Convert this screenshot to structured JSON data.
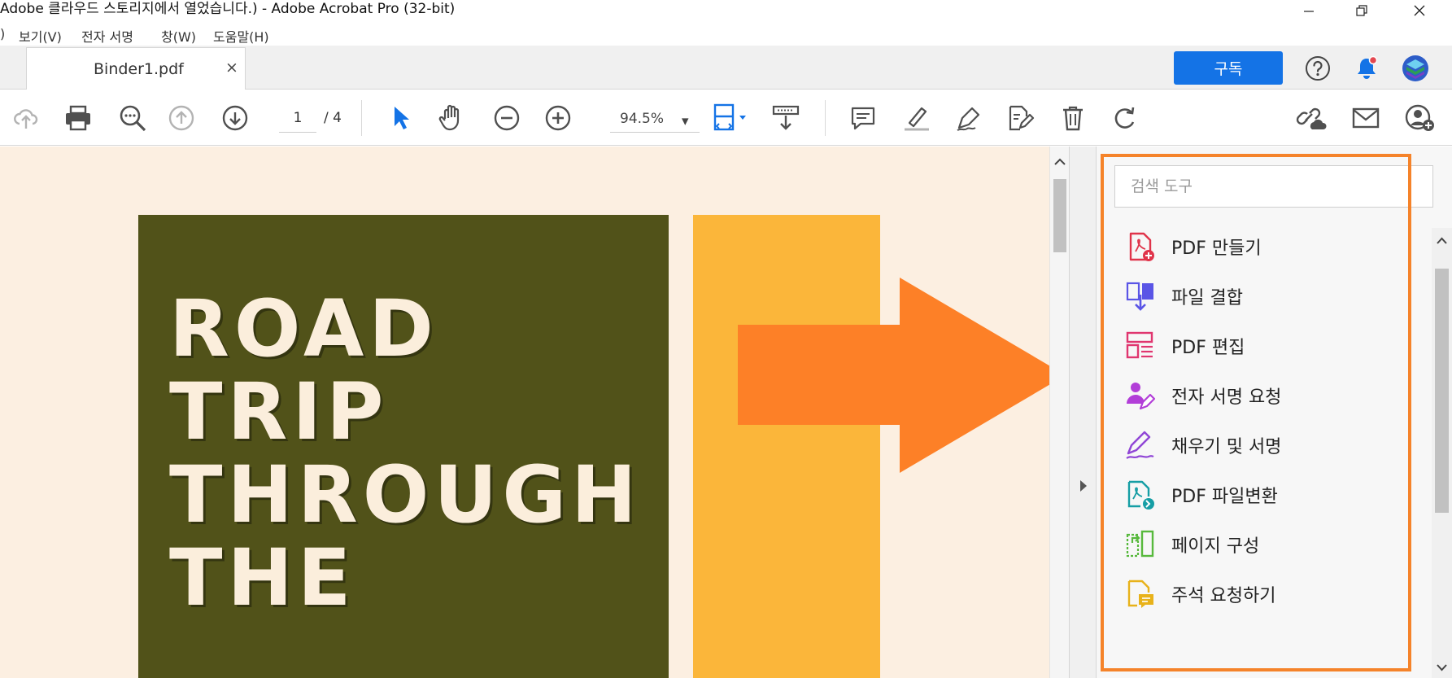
{
  "window": {
    "title": "Adobe 클라우드 스토리지에서 열었습니다.) - Adobe Acrobat Pro (32-bit)"
  },
  "menu": [
    ")",
    "보기(V)",
    "전자 서명",
    "창(W)",
    "도움말(H)"
  ],
  "tab": {
    "label": "Binder1.pdf",
    "close": "×"
  },
  "header": {
    "subscribe_label": "구독",
    "help": "?"
  },
  "toolbar": {
    "page_current": "1",
    "page_total": "/ 4",
    "zoom": "94.5%",
    "zoom_caret": "▾"
  },
  "document": {
    "lines": [
      "ROAD",
      "TRIP",
      "THROUGH",
      "THE"
    ],
    "colors": {
      "background": "#fcefe1",
      "green": "#515219",
      "yellow": "#fbb63a",
      "arrow": "#fd8027"
    }
  },
  "tools_pane": {
    "search_placeholder": "검색 도구",
    "items": [
      {
        "label": "PDF 만들기",
        "icon": "create-pdf-icon",
        "color": "#e0344a"
      },
      {
        "label": "파일 결합",
        "icon": "combine-files-icon",
        "color": "#5a55e6"
      },
      {
        "label": "PDF 편집",
        "icon": "edit-pdf-icon",
        "color": "#e0366f"
      },
      {
        "label": "전자 서명 요청",
        "icon": "request-signature-icon",
        "color": "#b23ed8"
      },
      {
        "label": "채우기 및 서명",
        "icon": "fill-sign-icon",
        "color": "#9046d6"
      },
      {
        "label": "PDF 파일변환",
        "icon": "export-pdf-icon",
        "color": "#169ea5"
      },
      {
        "label": "페이지 구성",
        "icon": "organize-pages-icon",
        "color": "#57b93c"
      },
      {
        "label": "주석 요청하기",
        "icon": "comment-icon",
        "color": "#e8b21a"
      }
    ],
    "highlight_color": "#f5832a"
  }
}
